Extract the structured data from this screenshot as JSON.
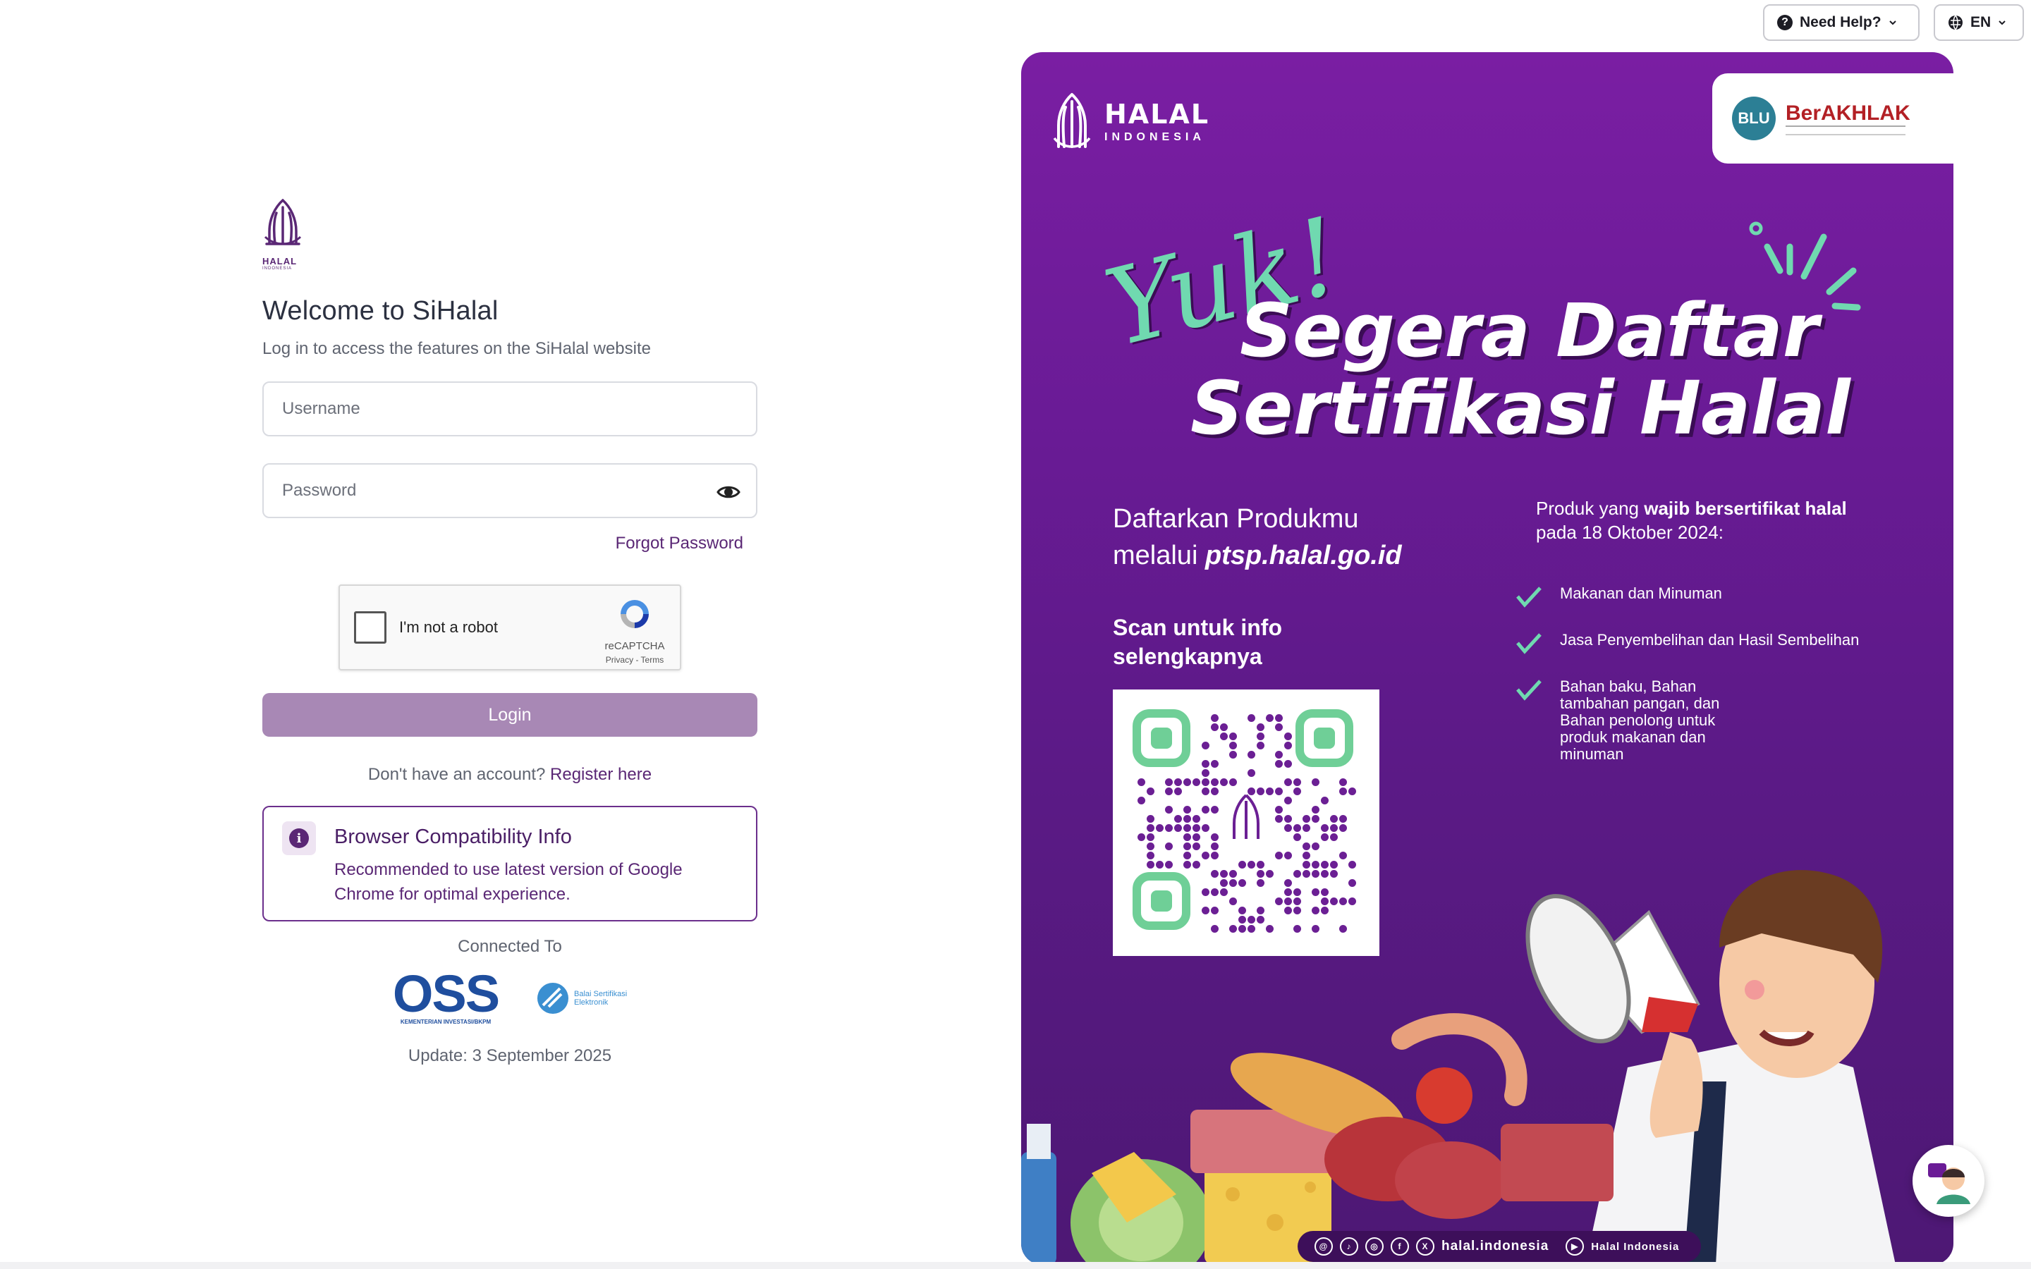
{
  "topbar": {
    "help_label": "Need Help?",
    "lang_label": "EN"
  },
  "login": {
    "logo_word": "HALAL",
    "logo_sub": "INDONESIA",
    "title": "Welcome to SiHalal",
    "subtitle": "Log in to access the features on the SiHalal website",
    "username_placeholder": "Username",
    "password_placeholder": "Password",
    "forgot_label": "Forgot Password",
    "captcha_label": "I'm not a robot",
    "captcha_brand": "reCAPTCHA",
    "captcha_links": "Privacy - Terms",
    "login_label": "Login",
    "register_prefix": "Don't have an account?",
    "register_link": "Register here",
    "info_title": "Browser Compatibility Info",
    "info_body": "Recommended to use latest version of Google Chrome for optimal experience.",
    "connected_label": "Connected To",
    "oss_label": "OSS",
    "oss_sub": "KEMENTERIAN INVESTASI/BKPM",
    "bsre_label": "Balai Sertifikasi Elektronik",
    "update_label": "Update: 3 September 2025"
  },
  "poster": {
    "brand_title": "HALAL",
    "brand_sub": "INDONESIA",
    "badge_blu": "BLU",
    "badge_ber": "BerAKHLAK",
    "yuk": "Yuk!",
    "headline_1": "Segera Daftar",
    "headline_2": "Sertifikasi Halal",
    "daftar_1": "Daftarkan Produkmu",
    "daftar_2_prefix": "melalui ",
    "daftar_2_url": "ptsp.halal.go.id",
    "scan_1": "Scan untuk info",
    "scan_2": "selengkapnya",
    "produk_prefix": "Produk yang ",
    "produk_bold": "wajib bersertifikat halal",
    "produk_date": "pada 18 Oktober 2024:",
    "list": [
      "Makanan dan Minuman",
      "Jasa Penyembelihan dan Hasil Sembelihan",
      "Bahan baku, Bahan tambahan pangan, dan Bahan penolong untuk produk makanan dan minuman"
    ],
    "social_handle": "halal.indonesia",
    "social_channel": "Halal Indonesia"
  },
  "colors": {
    "brand_purple": "#5a2775",
    "login_button": "#a888b5",
    "poster_bg": "#6a1b96",
    "accent_green": "#70d9b0"
  }
}
